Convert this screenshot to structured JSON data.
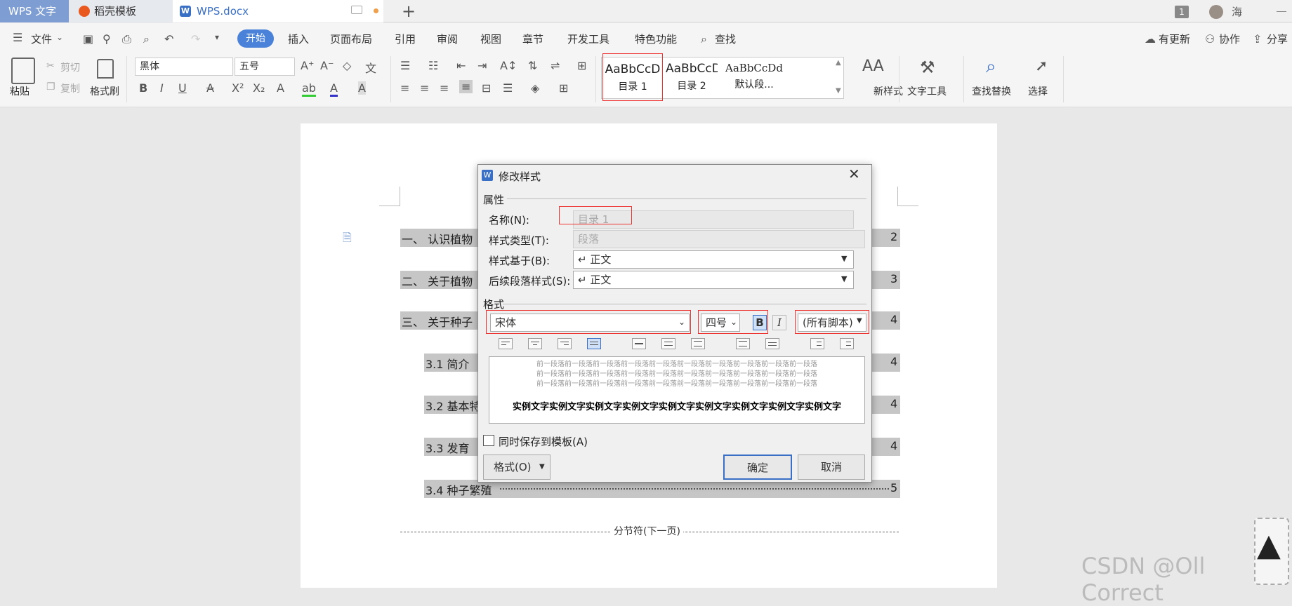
{
  "titlebar": {
    "app_tab": "WPS 文字",
    "template_tab": "稻壳模板",
    "doc_tab": "WPS.docx",
    "window_count": "1",
    "user": "海"
  },
  "menubar": {
    "file": "文件",
    "items": [
      "开始",
      "插入",
      "页面布局",
      "引用",
      "审阅",
      "视图",
      "章节",
      "开发工具",
      "特色功能"
    ],
    "search": "查找",
    "update": "有更新",
    "collab": "协作",
    "share": "分享"
  },
  "ribbon": {
    "paste": "粘贴",
    "cut": "剪切",
    "copy": "复制",
    "format_painter": "格式刷",
    "font": "黑体",
    "font_size": "五号",
    "styles": [
      {
        "sample": "AaBbCcD",
        "name": "目录 1"
      },
      {
        "sample": "AaBbCcD",
        "name": "目录 2"
      },
      {
        "sample": "AaBbCcDd",
        "name": "默认段..."
      }
    ],
    "new_style": "新样式",
    "text_tools": "文字工具",
    "find_replace": "查找替换",
    "select": "选择"
  },
  "document": {
    "toc": [
      {
        "text": "一、 认识植物",
        "page": "2"
      },
      {
        "text": "二、 关于植物",
        "page": "3"
      },
      {
        "text": "三、 关于种子",
        "page": "4"
      },
      {
        "text": "3.1 简介",
        "page": "4"
      },
      {
        "text": "3.2 基本特",
        "page": "4"
      },
      {
        "text": "3.3 发育",
        "page": "4"
      },
      {
        "text": "3.4 种子繁殖",
        "page": "5"
      }
    ],
    "section_break": "分节符(下一页)"
  },
  "dialog": {
    "title": "修改样式",
    "properties_label": "属性",
    "name_label": "名称(N):",
    "name_value": "目录 1",
    "type_label": "样式类型(T):",
    "type_value": "段落",
    "based_on_label": "样式基于(B):",
    "based_on_value": "↵ 正文",
    "next_style_label": "后续段落样式(S):",
    "next_style_value": "↵ 正文",
    "format_label": "格式",
    "font_value": "宋体",
    "size_value": "四号",
    "bold": "B",
    "italic": "I",
    "script_value": "(所有脚本)",
    "preview_prev": "前一段落前一段落前一段落前一段落前一段落前一段落前一段落前一段落前一段落前一段落",
    "preview_sample": "实例文字实例文字实例文字实例文字实例文字实例文字实例文字实例文字实例文字",
    "save_template": "同时保存到模板(A)",
    "format_button": "格式(O)",
    "ok": "确定",
    "cancel": "取消"
  },
  "watermark": "CSDN @Oll Correct"
}
